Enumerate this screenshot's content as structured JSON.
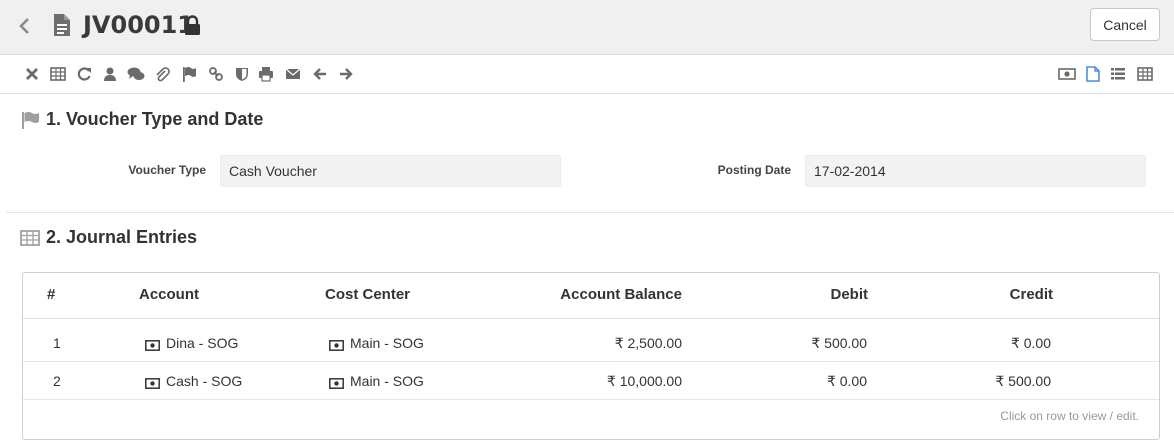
{
  "header": {
    "title": "JV00011",
    "cancel_label": "Cancel"
  },
  "toolbar": {
    "left_icons": [
      "close-icon",
      "table-icon",
      "refresh-icon",
      "user-icon",
      "comments-icon",
      "attachment-icon",
      "flag-icon",
      "link-icon",
      "shield-icon",
      "print-icon",
      "email-icon",
      "arrow-left-icon",
      "arrow-right-icon"
    ],
    "right_icons": [
      "money-icon",
      "file-icon",
      "list-icon",
      "table-icon"
    ]
  },
  "section1": {
    "title": "1. Voucher Type and Date",
    "voucher_type_label": "Voucher Type",
    "voucher_type_value": "Cash Voucher",
    "posting_date_label": "Posting Date",
    "posting_date_value": "17-02-2014"
  },
  "section2": {
    "title": "2. Journal Entries",
    "columns": {
      "num": "#",
      "account": "Account",
      "cost_center": "Cost Center",
      "balance": "Account Balance",
      "debit": "Debit",
      "credit": "Credit"
    },
    "rows": [
      {
        "num": "1",
        "account": "Dina - SOG",
        "cost_center": "Main - SOG",
        "balance": "₹ 2,500.00",
        "debit": "₹ 500.00",
        "credit": "₹ 0.00"
      },
      {
        "num": "2",
        "account": "Cash - SOG",
        "cost_center": "Main - SOG",
        "balance": "₹ 10,000.00",
        "debit": "₹ 0.00",
        "credit": "₹ 500.00"
      }
    ],
    "hint": "Click on row to view / edit."
  },
  "colors": {
    "header_bg": "#f0f0f0",
    "icon_gray": "#6b6b6b",
    "active_icon_blue": "#4a90d9"
  }
}
